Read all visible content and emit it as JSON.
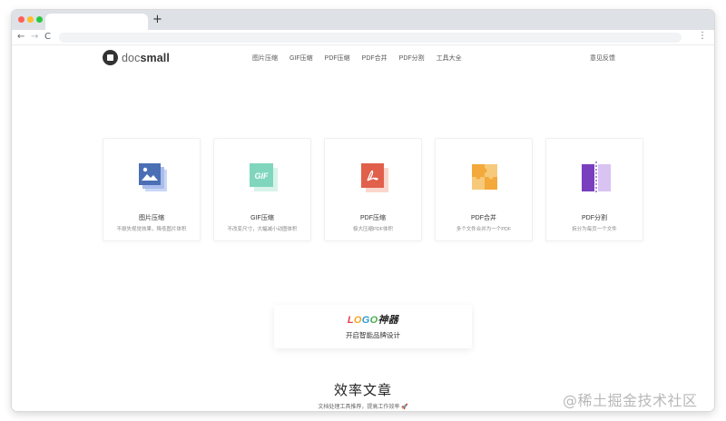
{
  "browser": {
    "new_tab_glyph": "+",
    "back_glyph": "←",
    "forward_glyph": "→",
    "reload_glyph": "C",
    "menu_glyph": "⋮",
    "colors": {
      "close": "#ff5f57",
      "minimize": "#febc2e",
      "maximize": "#28c840"
    }
  },
  "header": {
    "logo_doc": "doc",
    "logo_small": "small",
    "nav": [
      "图片压缩",
      "GIF压缩",
      "PDF压缩",
      "PDF合并",
      "PDF分割",
      "工具大全"
    ],
    "feedback": "意见反馈"
  },
  "tools": [
    {
      "title": "图片压缩",
      "desc": "不损失视觉效果，降低图片体积",
      "icon": "image-compress-icon",
      "color": "#4a6fb5"
    },
    {
      "title": "GIF压缩",
      "desc": "不改变尺寸，大幅减小动图体积",
      "icon": "gif-compress-icon",
      "color": "#6fcfb2"
    },
    {
      "title": "PDF压缩",
      "desc": "极大压缩PDF体积",
      "icon": "pdf-compress-icon",
      "color": "#e0604c"
    },
    {
      "title": "PDF合并",
      "desc": "多个文件合并为一个PDF",
      "icon": "pdf-merge-icon",
      "color": "#f3a93b"
    },
    {
      "title": "PDF分割",
      "desc": "拆分为每页一个文件",
      "icon": "pdf-split-icon",
      "color": "#7a3fbf"
    }
  ],
  "gif_icon_text": "GIF",
  "promo": {
    "logo_letters": [
      "L",
      "O",
      "G",
      "O"
    ],
    "logo_suffix": "神器",
    "subtitle": "开启智能品牌设计"
  },
  "articles": {
    "title": "效率文章",
    "subtitle": "文档处理工具推荐，提高工作效率 🚀"
  },
  "watermark": "@稀土掘金技术社区"
}
